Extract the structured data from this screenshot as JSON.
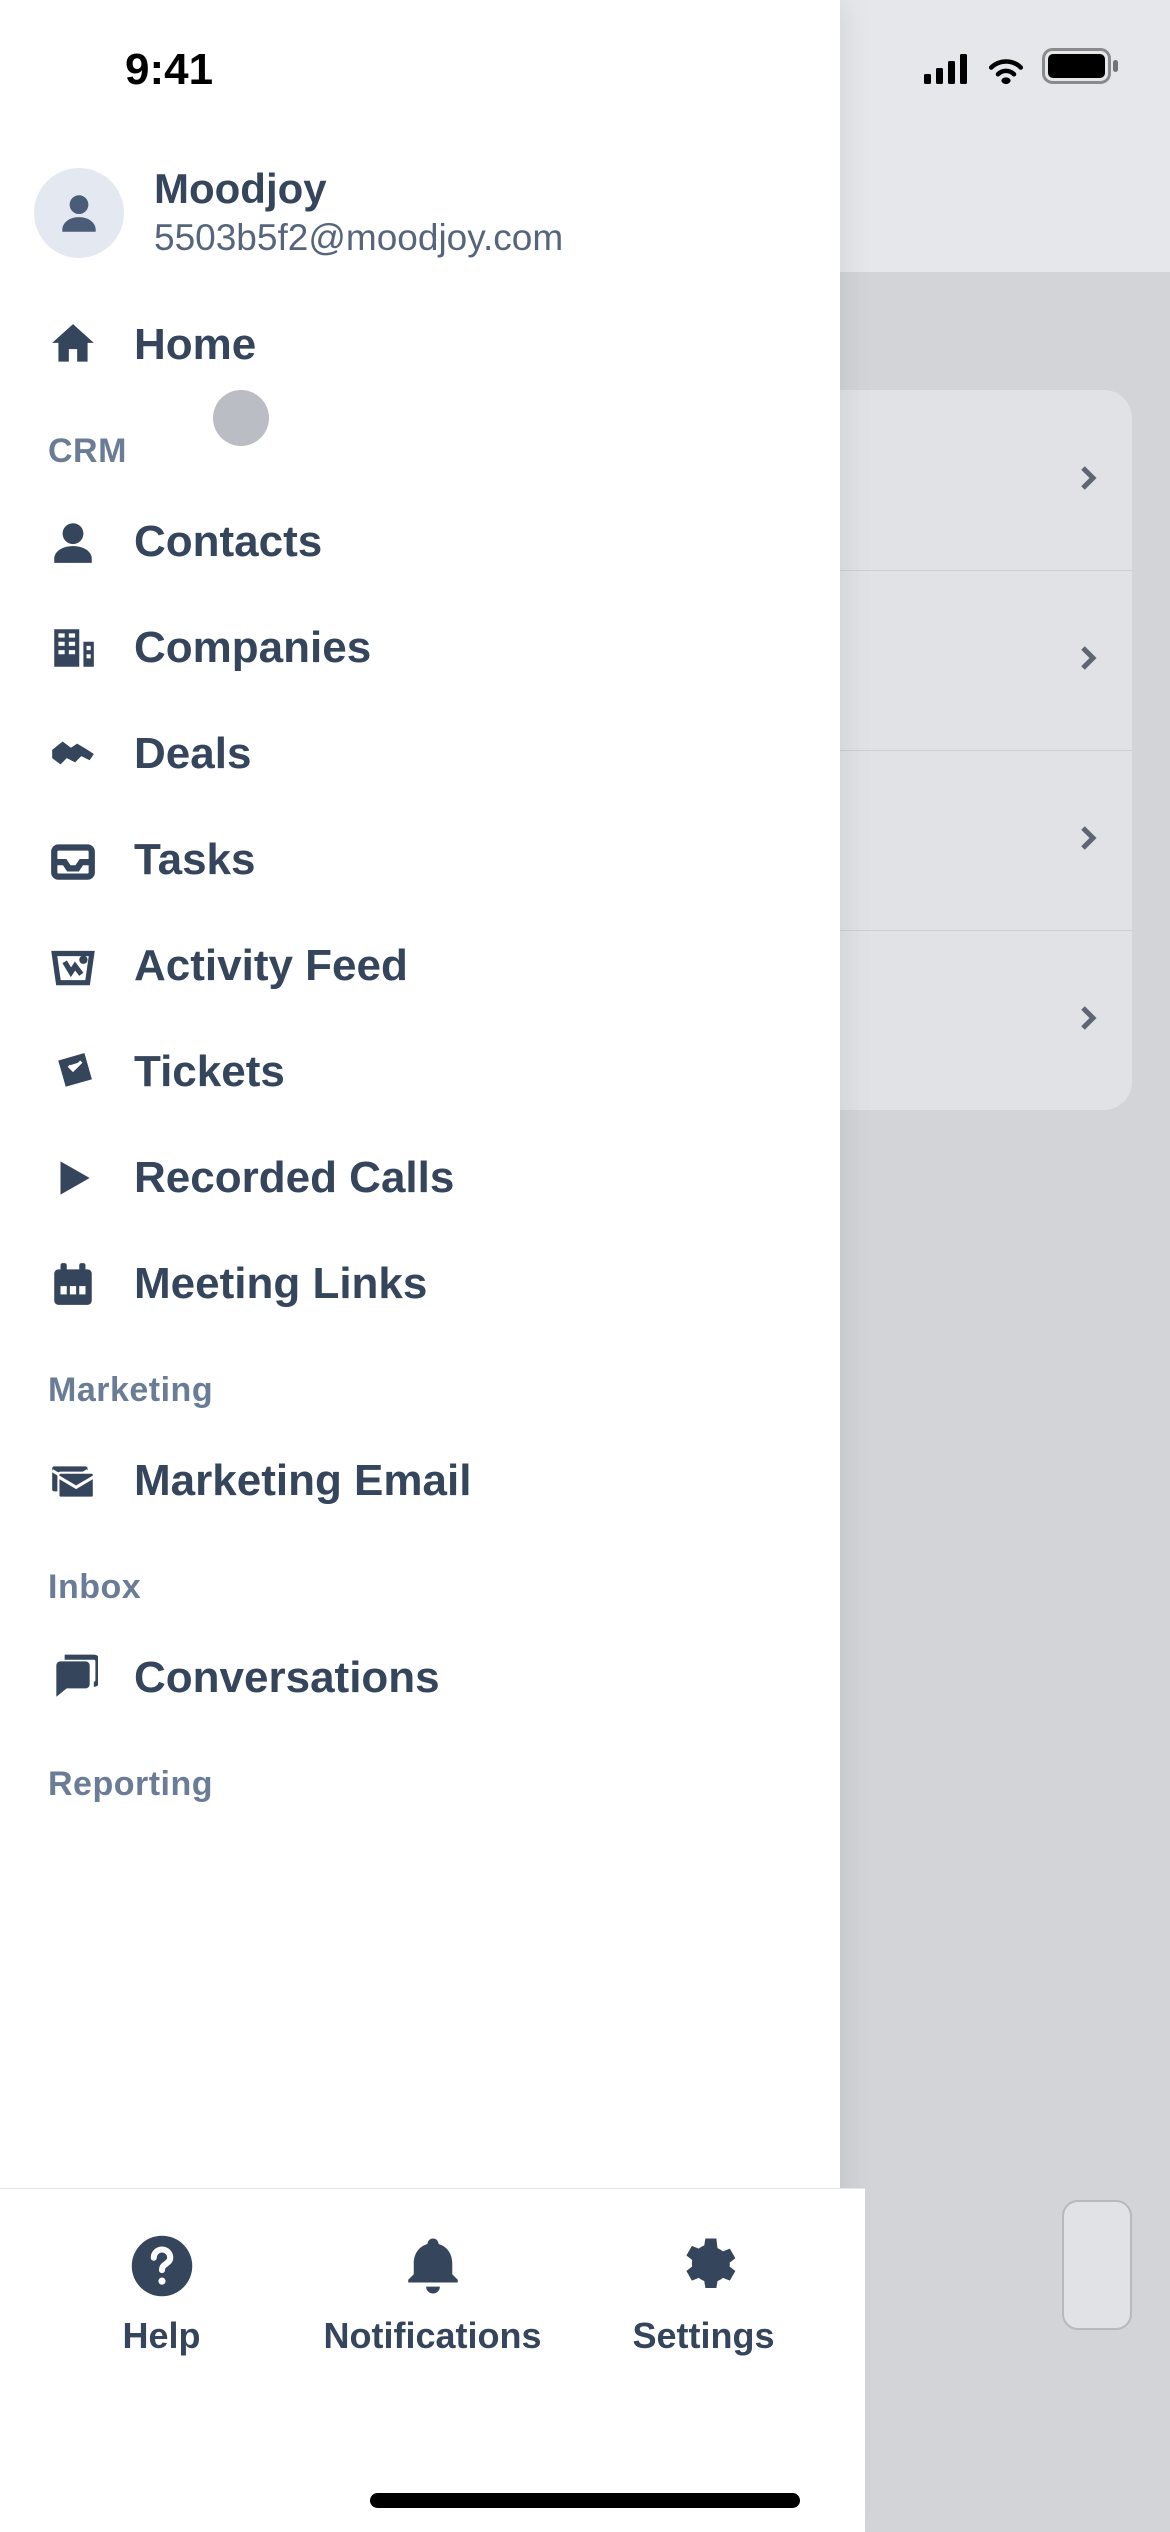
{
  "status": {
    "time": "9:41"
  },
  "profile": {
    "name": "Moodjoy",
    "email": "5503b5f2@moodjoy.com"
  },
  "nav": {
    "home": "Home",
    "sections": {
      "crm": {
        "header": "CRM",
        "items": {
          "contacts": "Contacts",
          "companies": "Companies",
          "deals": "Deals",
          "tasks": "Tasks",
          "activity": "Activity Feed",
          "tickets": "Tickets",
          "recorded": "Recorded Calls",
          "meeting": "Meeting Links"
        }
      },
      "marketing": {
        "header": "Marketing",
        "items": {
          "email": "Marketing Email"
        }
      },
      "inbox": {
        "header": "Inbox",
        "items": {
          "conversations": "Conversations"
        }
      },
      "reporting": {
        "header": "Reporting"
      }
    }
  },
  "bottom": {
    "help": "Help",
    "notifications": "Notifications",
    "settings": "Settings"
  }
}
